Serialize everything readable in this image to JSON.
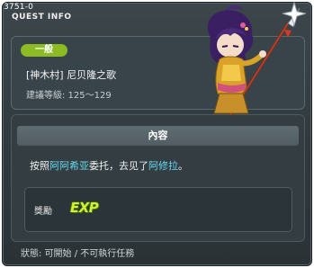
{
  "quest_id": "3751-0",
  "window_title": "QUEST INFO",
  "quest": {
    "category": "一般",
    "name": "[神木村] 尼贝隆之歌",
    "level_label": "建議等級: 125～129"
  },
  "content": {
    "header": "內容",
    "desc_prefix": "按照",
    "npc_from": "阿阿希亚",
    "desc_mid": "委托，去见了",
    "npc_to": "阿修拉",
    "desc_suffix": "。"
  },
  "reward": {
    "label": "獎勵",
    "item_text": "EXP"
  },
  "status_text": "狀態: 可開始 / 不可執行任務",
  "colors": {
    "badge": "#8cbb24",
    "npc_highlight": "#66d9ef",
    "exp": "#d4ee35"
  }
}
